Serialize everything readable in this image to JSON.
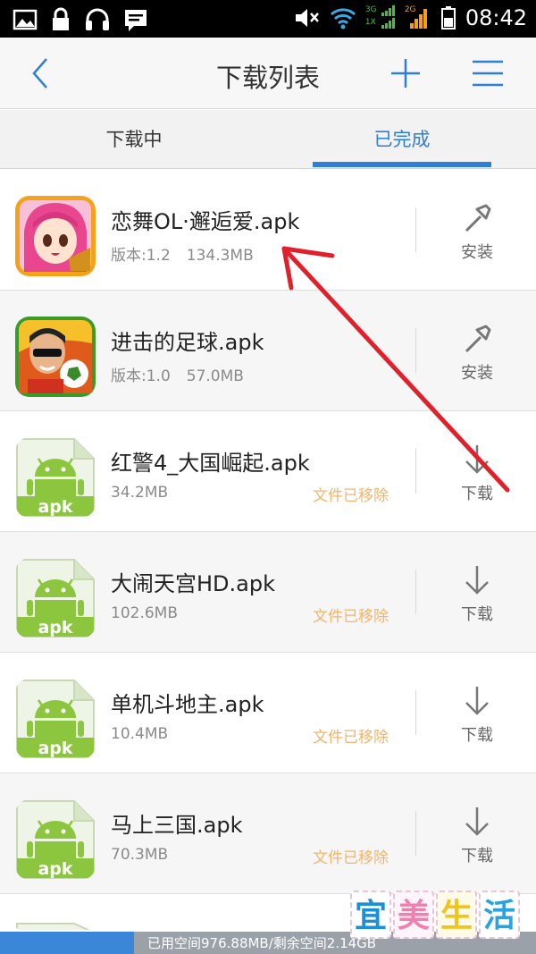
{
  "status_bar": {
    "time": "08:42",
    "icons": [
      "image-icon",
      "lock-icon",
      "headset-icon",
      "message-icon",
      "mute-icon",
      "wifi-icon",
      "signal-icon",
      "battery-icon"
    ],
    "signal_labels": [
      "3G",
      "1X",
      "2G"
    ]
  },
  "header": {
    "title": "下载列表",
    "back_icon": "chevron-left-icon",
    "add_icon": "plus-icon",
    "menu_icon": "menu-icon"
  },
  "tabs": [
    {
      "label": "下载中",
      "active": false
    },
    {
      "label": "已完成",
      "active": true
    }
  ],
  "items": [
    {
      "name": "恋舞OL·邂逅爱.apk",
      "version": "版本:1.2",
      "size": "134.3MB",
      "status": "",
      "action": "安装",
      "action_icon": "wrench-icon",
      "icon": "game-anime-girl-icon"
    },
    {
      "name": "进击的足球.apk",
      "version": "版本:1.0",
      "size": "57.0MB",
      "status": "",
      "action": "安装",
      "action_icon": "wrench-icon",
      "icon": "game-soccer-icon"
    },
    {
      "name": "红警4_大国崛起.apk",
      "version": "",
      "size": "34.2MB",
      "status": "文件已移除",
      "action": "下载",
      "action_icon": "download-arrow-icon",
      "icon": "android-apk-icon"
    },
    {
      "name": "大闹天宫HD.apk",
      "version": "",
      "size": "102.6MB",
      "status": "文件已移除",
      "action": "下载",
      "action_icon": "download-arrow-icon",
      "icon": "android-apk-icon"
    },
    {
      "name": "单机斗地主.apk",
      "version": "",
      "size": "10.4MB",
      "status": "文件已移除",
      "action": "下载",
      "action_icon": "download-arrow-icon",
      "icon": "android-apk-icon"
    },
    {
      "name": "马上三国.apk",
      "version": "",
      "size": "70.3MB",
      "status": "文件已移除",
      "action": "下载",
      "action_icon": "download-arrow-icon",
      "icon": "android-apk-icon"
    }
  ],
  "apk_label": "apk",
  "storage": {
    "text": "已用空间976.88MB/剩余空间2.14GB",
    "used_fraction": 0.25
  },
  "watermark": {
    "chars": [
      "宜",
      "美",
      "生",
      "活"
    ]
  },
  "colors": {
    "accent": "#2f7fd6",
    "removed": "#f3b46b",
    "annotation_arrow": "#e0202a",
    "android_green": "#8cc63f"
  }
}
